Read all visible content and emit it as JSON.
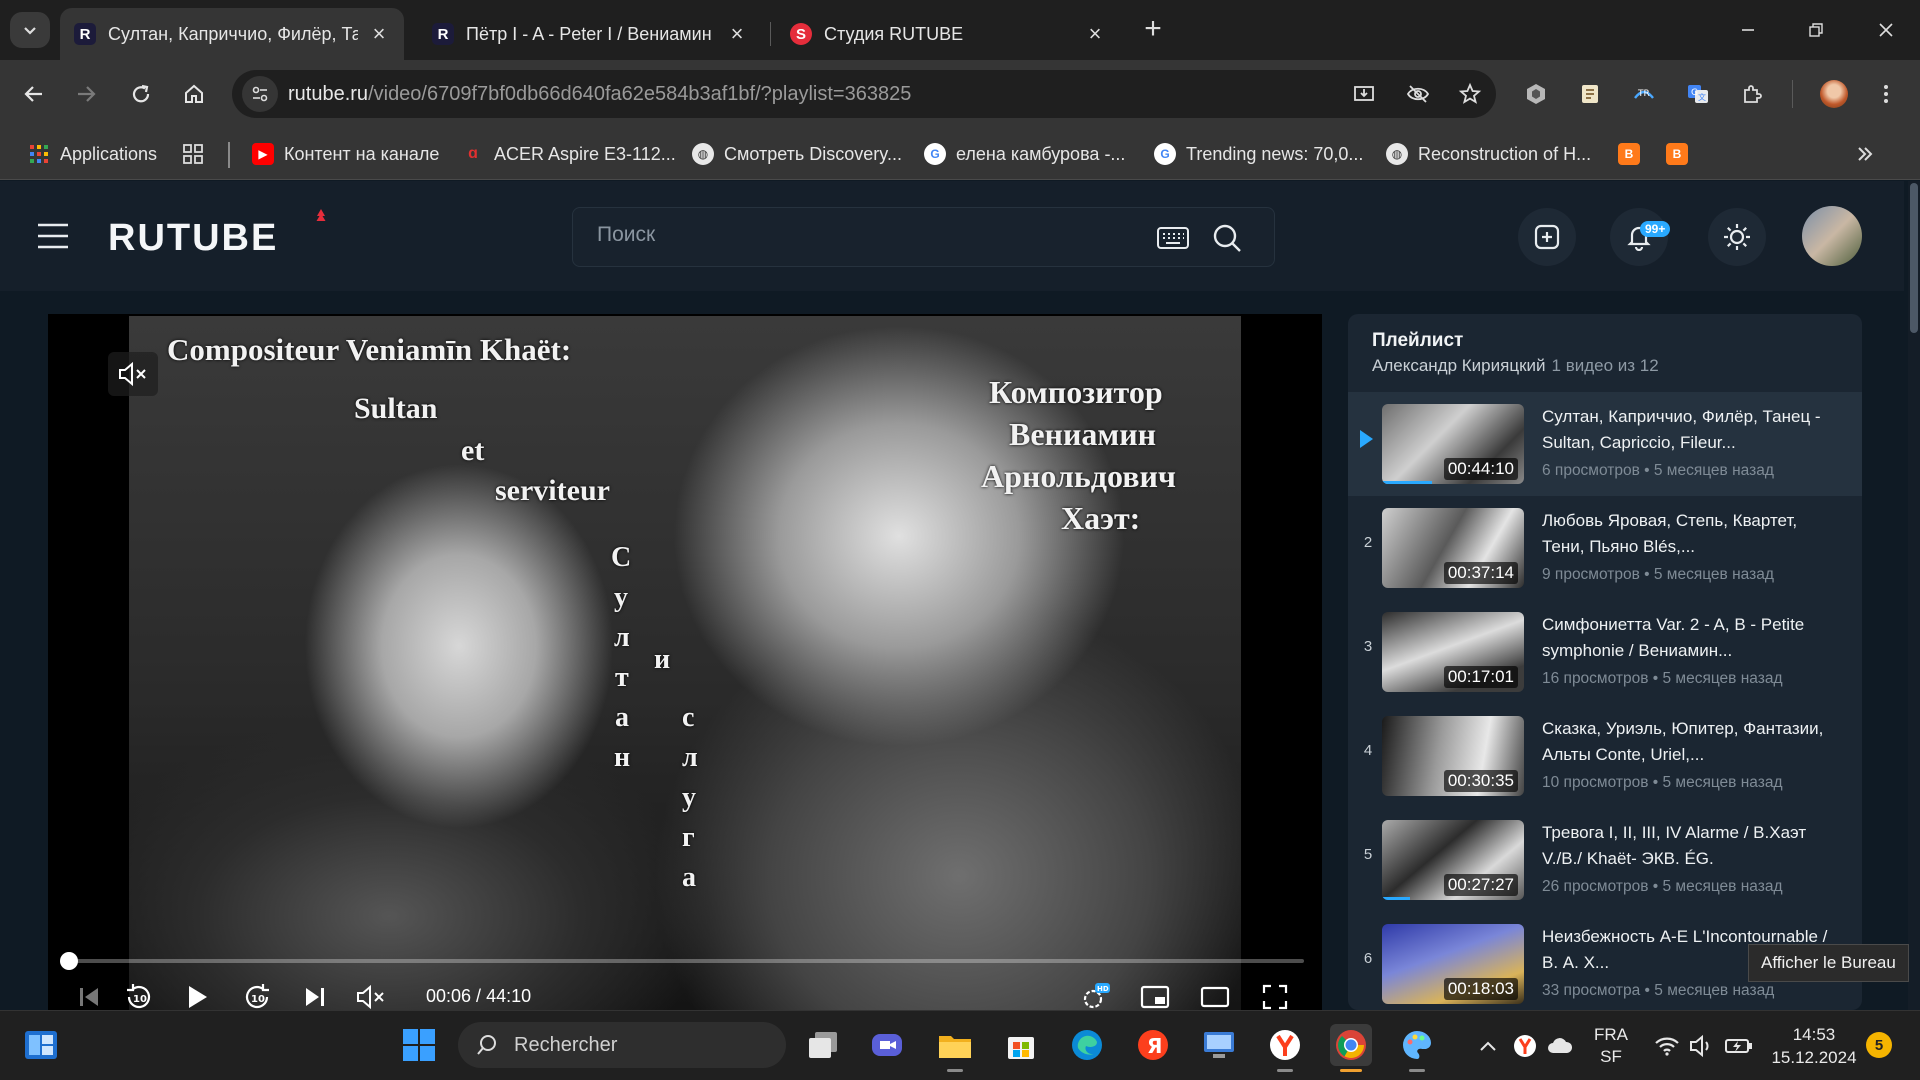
{
  "browser": {
    "tabs": [
      {
        "title": "Султан, Каприччио, Филёр, Танец",
        "active": true
      },
      {
        "title": "Пётр I - A - Peter I / Вениамин",
        "active": false
      },
      {
        "title": "Студия RUTUBE",
        "active": false
      }
    ],
    "url_host": "rutube.ru",
    "url_path": "/video/6709f7bf0db66d640fa62e584b3af1bf/?playlist=363825",
    "bookmarks": [
      {
        "label": "Applications",
        "icon": "apps-grid-icon"
      },
      {
        "label": "Контент на канале",
        "icon": "youtube-icon"
      },
      {
        "label": "ACER Aspire E3-112...",
        "icon": "acer-icon"
      },
      {
        "label": "Смотреть Discovery...",
        "icon": "globe-icon"
      },
      {
        "label": "елена камбурова -...",
        "icon": "google-icon"
      },
      {
        "label": "Trending news: 70,0...",
        "icon": "google-icon"
      },
      {
        "label": "Reconstruction of H...",
        "icon": "globe-icon"
      }
    ]
  },
  "site": {
    "logo": "RUTUBE",
    "search_placeholder": "Поиск",
    "notifications_badge": "99+"
  },
  "player": {
    "current_time": "00:06",
    "duration": "44:10",
    "progress_fraction": 0.0023,
    "frame_text": {
      "fr_line1": "Compositeur Veniamīn Khaët:",
      "fr_line2": "Sultan",
      "fr_line3": "et",
      "fr_line4": "serviteur",
      "ru_line1": "Композитор",
      "ru_line2": "Вениамин",
      "ru_line3": "Арнольдович",
      "ru_line4": "Хаэт:",
      "vertical_a": [
        "С",
        "у",
        "л",
        "т",
        "а",
        "н"
      ],
      "vertical_b": "и",
      "vertical_c": [
        "с",
        "л",
        "у",
        "г",
        "а"
      ]
    }
  },
  "playlist": {
    "heading": "Плейлист",
    "author": "Александр Кирияцкий",
    "count": "1 видео из 12",
    "items": [
      {
        "num": "",
        "title": "Султан, Каприччио, Филёр, Танец - Sultan, Capriccio, Fileur...",
        "duration": "00:44:10",
        "views": "6 просмотров",
        "age": "5 месяцев назад",
        "current": true,
        "watched": 0.35
      },
      {
        "num": "2",
        "title": "Любовь Яровая, Степь, Квартет, Тени, Пьяно Blés,...",
        "duration": "00:37:14",
        "views": "9 просмотров",
        "age": "5 месяцев назад",
        "current": false,
        "watched": 0
      },
      {
        "num": "3",
        "title": "Симфониетта Var. 2 - A, B - Petite symphonie / Вениамин...",
        "duration": "00:17:01",
        "views": "16 просмотров",
        "age": "5 месяцев назад",
        "current": false,
        "watched": 0
      },
      {
        "num": "4",
        "title": "Сказка, Уриэль, Юпитер, Фантазии, Альты Conte, Uriel,...",
        "duration": "00:30:35",
        "views": "10 просмотров",
        "age": "5 месяцев назад",
        "current": false,
        "watched": 0
      },
      {
        "num": "5",
        "title": "Тревога I, II, III, IV Alarme / В.Хаэт V./B./ Khaët- ЭКВ. ÉG.",
        "duration": "00:27:27",
        "views": "26 просмотров",
        "age": "5 месяцев назад",
        "current": false,
        "watched": 0.2
      },
      {
        "num": "6",
        "title": "Неизбежность A-E L'Incontournable / В. А. Х...",
        "duration": "00:18:03",
        "views": "33 просмотра",
        "age": "5 месяцев назад",
        "current": false,
        "watched": 0
      }
    ]
  },
  "tooltip": "Afficher le Bureau",
  "taskbar": {
    "search_label": "Rechercher",
    "lang_line1": "FRA",
    "lang_line2": "SF",
    "time": "14:53",
    "date": "15.12.2024",
    "notification_count": "5"
  }
}
